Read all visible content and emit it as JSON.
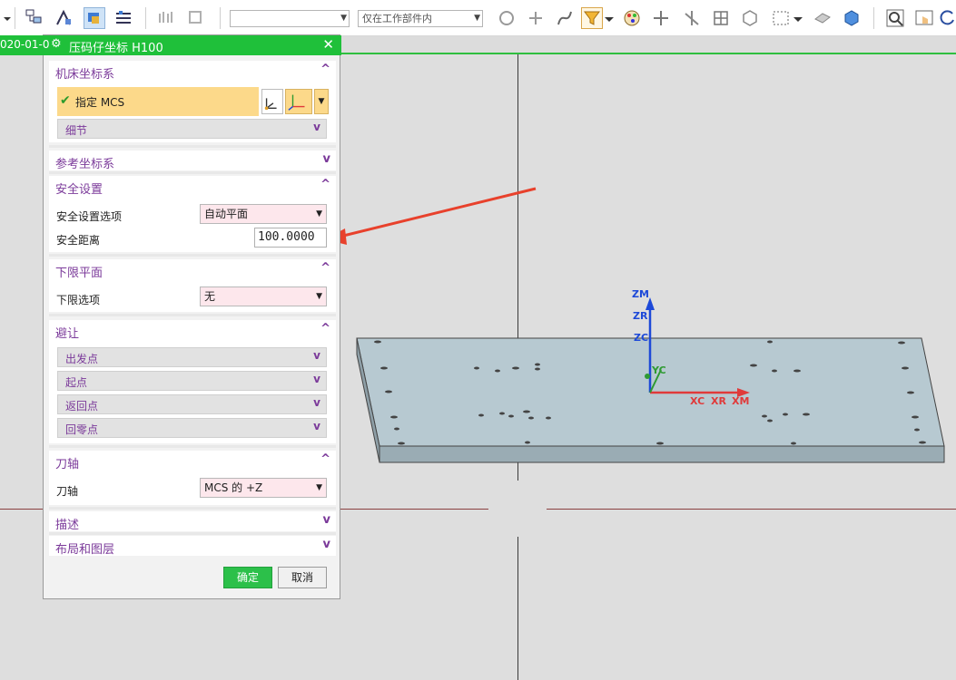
{
  "toolbar": {
    "combo1_value": "",
    "combo2_value": "仅在工作部件内"
  },
  "dialog": {
    "date_fragment": "020-01-0",
    "title": "压码仔坐标 H100",
    "close_symbol": "✕",
    "sections": {
      "machine_cs": {
        "label": "机床坐标系",
        "specify_mcs": "指定 MCS",
        "detail": "细节"
      },
      "reference_cs": {
        "label": "参考坐标系"
      },
      "safety": {
        "label": "安全设置",
        "option_label": "安全设置选项",
        "option_value": "自动平面",
        "distance_label": "安全距离",
        "distance_value": "100.0000"
      },
      "lower_plane": {
        "label": "下限平面",
        "option_label": "下限选项",
        "option_value": "无"
      },
      "avoidance": {
        "label": "避让",
        "items": [
          "出发点",
          "起点",
          "返回点",
          "回零点"
        ]
      },
      "tool_axis": {
        "label": "刀轴",
        "axis_label": "刀轴",
        "axis_value": "MCS 的 +Z"
      },
      "description": {
        "label": "描述"
      },
      "layout_layers": {
        "label": "布局和图层"
      }
    },
    "ok_label": "确定",
    "cancel_label": "取消"
  },
  "viewport": {
    "axis_labels": {
      "zm": "ZM",
      "zr": "ZR",
      "zc": "ZC",
      "xc": "XC",
      "xr": "XR",
      "xm": "XM",
      "yc": "YC"
    },
    "accent_color": "#2fbf3f",
    "x_axis_color": "#e03a3a",
    "z_axis_color": "#1d49d8",
    "y_axis_color": "#2e9a32"
  }
}
